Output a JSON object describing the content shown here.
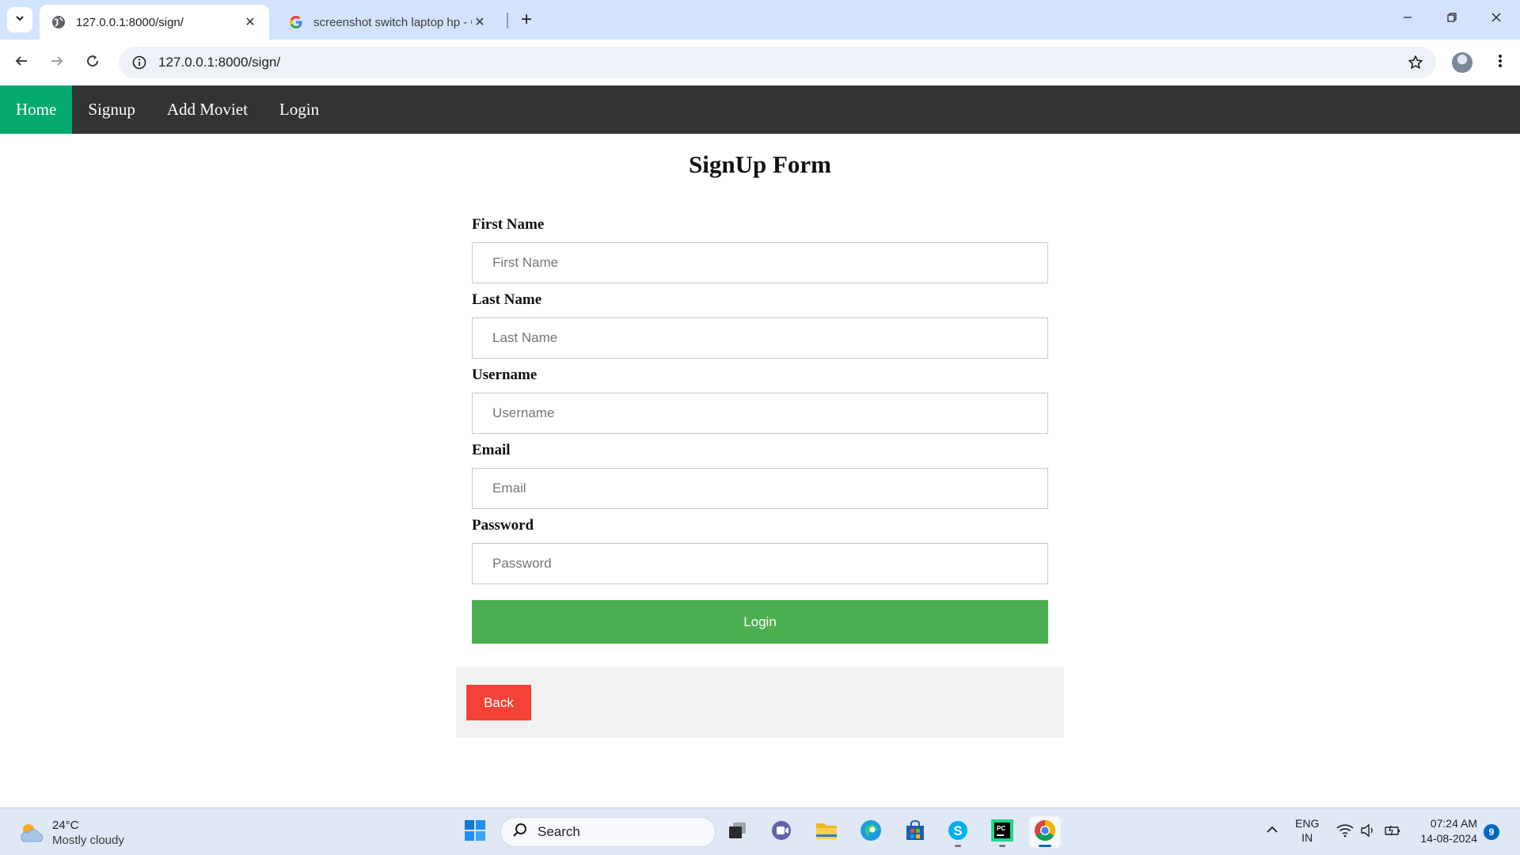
{
  "browser": {
    "tabs": [
      {
        "title": "127.0.0.1:8000/sign/",
        "active": true
      },
      {
        "title": "screenshot switch laptop hp - G",
        "active": false
      }
    ],
    "url": "127.0.0.1:8000/sign/"
  },
  "navbar": {
    "items": [
      {
        "label": "Home",
        "active": true
      },
      {
        "label": "Signup",
        "active": false
      },
      {
        "label": "Add Moviet",
        "active": false
      },
      {
        "label": "Login",
        "active": false
      }
    ]
  },
  "form": {
    "title": "SignUp Form",
    "fields": [
      {
        "label": "First Name",
        "placeholder": "First Name",
        "value": ""
      },
      {
        "label": "Last Name",
        "placeholder": "Last Name",
        "value": ""
      },
      {
        "label": "Username",
        "placeholder": "Username",
        "value": ""
      },
      {
        "label": "Email",
        "placeholder": "Email",
        "value": ""
      },
      {
        "label": "Password",
        "placeholder": "Password",
        "value": ""
      }
    ],
    "submit_label": "Login",
    "back_label": "Back"
  },
  "colors": {
    "nav_bg": "#333333",
    "nav_active": "#04aa6d",
    "submit": "#4caf50",
    "back": "#f44336"
  },
  "taskbar": {
    "weather": {
      "temp": "24°C",
      "condition": "Mostly cloudy"
    },
    "search_label": "Search",
    "apps": [
      "windows-start-icon",
      "task-view-icon",
      "teams-icon",
      "file-explorer-icon",
      "edge-icon",
      "store-icon",
      "skype-icon",
      "pycharm-icon",
      "chrome-icon"
    ],
    "language": {
      "lang": "ENG",
      "region": "IN"
    },
    "time": "07:24 AM",
    "date": "14-08-2024",
    "notification_count": "9"
  }
}
